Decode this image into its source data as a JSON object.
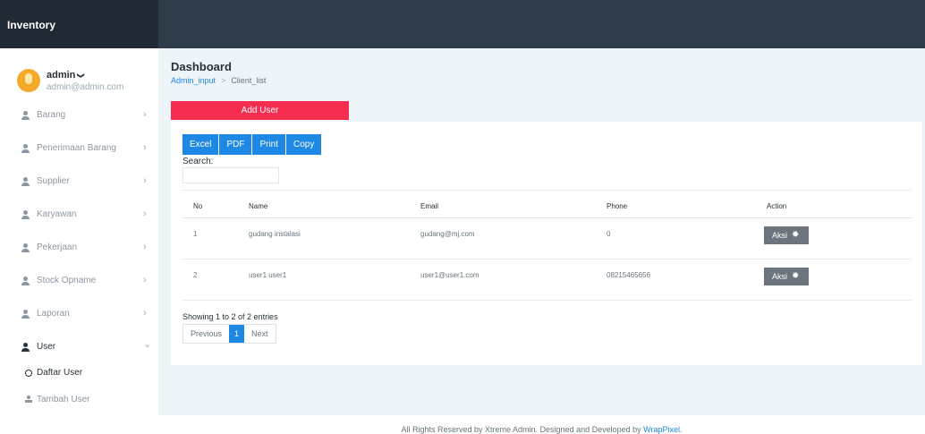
{
  "app": {
    "brand": "Inventory"
  },
  "profile": {
    "name": "admin",
    "chevron": "❯",
    "email": "admin@admin.com"
  },
  "sidebar": {
    "items": [
      {
        "label": "Barang",
        "icon": "user-icon",
        "chevron": "›"
      },
      {
        "label": "Penerimaan Barang",
        "icon": "user-icon",
        "chevron": "›"
      },
      {
        "label": "Supplier",
        "icon": "user-icon",
        "chevron": "›"
      },
      {
        "label": "Karyawan",
        "icon": "user-icon",
        "chevron": "›"
      },
      {
        "label": "Pekerjaan",
        "icon": "user-icon",
        "chevron": "›"
      },
      {
        "label": "Stock Opname",
        "icon": "user-icon",
        "chevron": "›"
      },
      {
        "label": "Laporan",
        "icon": "user-icon",
        "chevron": "›"
      },
      {
        "label": "User",
        "icon": "user-icon",
        "chevron": "⌄"
      }
    ],
    "subitems": [
      {
        "label": "Daftar User",
        "icon": "circle-icon"
      },
      {
        "label": "Tambah User",
        "icon": "user-icon"
      }
    ]
  },
  "page": {
    "title": "Dashboard",
    "breadcrumb": {
      "first": "Admin_input",
      "separator": ">",
      "current": "Client_list"
    },
    "add_button": "Add User"
  },
  "table_tools": {
    "export_buttons": [
      "Excel",
      "PDF",
      "Print",
      "Copy"
    ],
    "search_label": "Search:",
    "search_value": ""
  },
  "table": {
    "headers": [
      "No",
      "Name",
      "Email",
      "Phone",
      "Action"
    ],
    "rows": [
      {
        "no": "1",
        "name": "gudang instalasi",
        "email": "gudang@mj.com",
        "phone": "0",
        "action": "Aksi"
      },
      {
        "no": "2",
        "name": "user1 user1",
        "email": "user1@user1.com",
        "phone": "08215465656",
        "action": "Aksi"
      }
    ],
    "info": "Showing 1 to 2 of 2 entries",
    "pagination": {
      "previous": "Previous",
      "current": "1",
      "next": "Next"
    }
  },
  "footer": {
    "text": "All Rights Reserved by Xtreme Admin. Designed and Developed by ",
    "link": "WrapPixel",
    "end": "."
  },
  "colors": {
    "topbar": "#2f3d4a",
    "accent_red": "#f62d51",
    "accent_blue": "#1e88e5",
    "action_gray": "#6c757d",
    "content_bg": "#eef5f9"
  }
}
